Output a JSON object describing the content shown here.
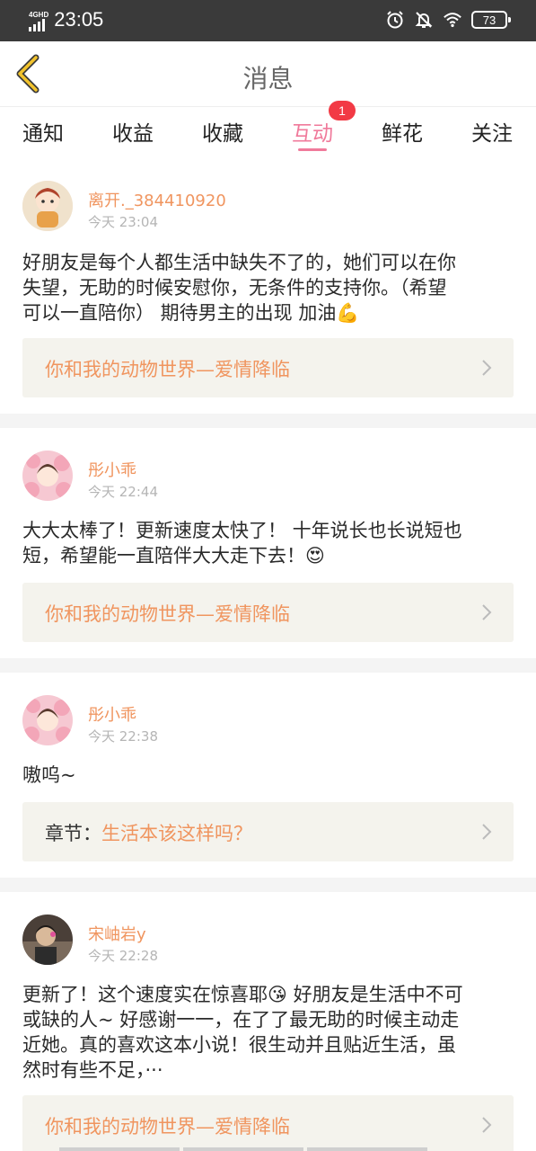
{
  "status_bar": {
    "network_label": "4GHD",
    "time": "23:05",
    "battery": "73"
  },
  "header": {
    "title": "消息"
  },
  "tabs": [
    {
      "label": "通知",
      "active": false
    },
    {
      "label": "收益",
      "active": false
    },
    {
      "label": "收藏",
      "active": false
    },
    {
      "label": "互动",
      "active": true,
      "badge": "1"
    },
    {
      "label": "鲜花",
      "active": false
    },
    {
      "label": "关注",
      "active": false
    }
  ],
  "messages": [
    {
      "username": "离开._384410920",
      "time": "今天 23:04",
      "lines": [
        "好朋友是每个人都生活中缺失不了的，她们可以在你",
        "失望，无助的时候安慰你，无条件的支持你。（希望",
        "可以一直陪你） 期待男主的出现 加油💪"
      ],
      "link_prefix": "",
      "link_text": "你和我的动物世界—爱情降临"
    },
    {
      "username": "彤小乖",
      "time": "今天 22:44",
      "lines": [
        "大大太棒了！更新速度太快了！ 十年说长也长说短也",
        "短，希望能一直陪伴大大走下去！😍"
      ],
      "link_prefix": "",
      "link_text": "你和我的动物世界—爱情降临"
    },
    {
      "username": "彤小乖",
      "time": "今天 22:38",
      "lines": [
        "嗷呜~"
      ],
      "link_prefix": "章节：",
      "link_text": "生活本该这样吗？"
    },
    {
      "username": "宋岫岩y",
      "time": "今天 22:28",
      "lines": [
        "更新了！这个速度实在惊喜耶😘 好朋友是生活中不可",
        "或缺的人~ 好感谢一一，在了了最无助的时候主动走",
        "近她。真的喜欢这本小说！很生动并且贴近生活，虽",
        "然时有些不足，···"
      ],
      "link_prefix": "",
      "link_text": "你和我的动物世界—爱情降临"
    }
  ],
  "colors": {
    "accent_pink": "#f07a9b",
    "username_orange": "#f0955f",
    "badge_red": "#f23a45",
    "back_arrow_yellow": "#f2c32c",
    "link_bg": "#f4f3ed"
  },
  "icons": {
    "back": "chevron-left-icon",
    "alarm": "alarm-icon",
    "mute": "bell-off-icon",
    "wifi": "wifi-icon",
    "link_arrow": "chevron-right-icon"
  }
}
